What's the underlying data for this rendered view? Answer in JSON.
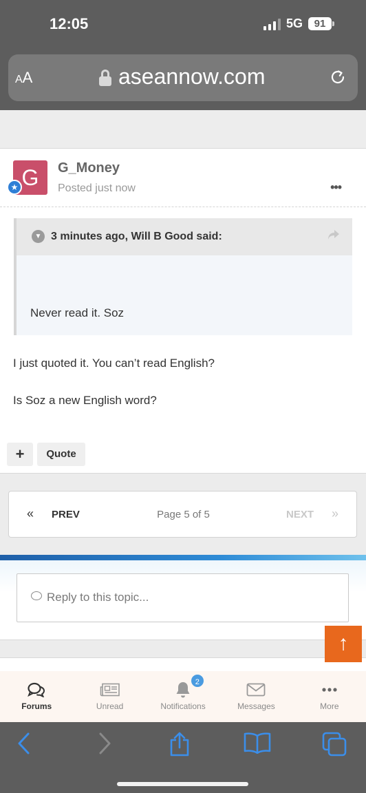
{
  "status_bar": {
    "time": "12:05",
    "network": "5G",
    "battery": "91"
  },
  "browser": {
    "aa_label_small": "A",
    "aa_label_big": "A",
    "domain": "aseannow.com"
  },
  "post": {
    "avatar_letter": "G",
    "author": "G_Money",
    "posted": "Posted just now",
    "more": "•••",
    "quote": {
      "title": "3 minutes ago, Will B Good said:",
      "body": "Never read it. Soz"
    },
    "paragraphs": [
      "I just quoted it.  You can’t read English?",
      "Is Soz a new English word?"
    ],
    "actions": {
      "plus": "+",
      "quote": "Quote"
    }
  },
  "pagination": {
    "prev_arrow": "«",
    "prev_label": "PREV",
    "page_text": "Page 5 of 5",
    "next_label": "NEXT",
    "next_arrow": "»"
  },
  "reply": {
    "placeholder": "Reply to this topic..."
  },
  "scroll_top": {
    "arrow": "↑"
  },
  "bottom_nav": {
    "items": [
      {
        "label": "Forums",
        "icon": "forums-icon"
      },
      {
        "label": "Unread",
        "icon": "newspaper-icon"
      },
      {
        "label": "Notifications",
        "icon": "bell-icon",
        "badge": "2"
      },
      {
        "label": "Messages",
        "icon": "envelope-icon"
      },
      {
        "label": "More",
        "icon": "more-icon"
      }
    ]
  },
  "safari_toolbar": {
    "icons": [
      "back-icon",
      "forward-icon",
      "share-icon",
      "bookmarks-icon",
      "tabs-icon"
    ]
  },
  "colors": {
    "avatar": "#c94f6a",
    "scroll_top": "#e8681d",
    "safari_accent": "#3b8eea",
    "badge": "#4a9be0"
  }
}
